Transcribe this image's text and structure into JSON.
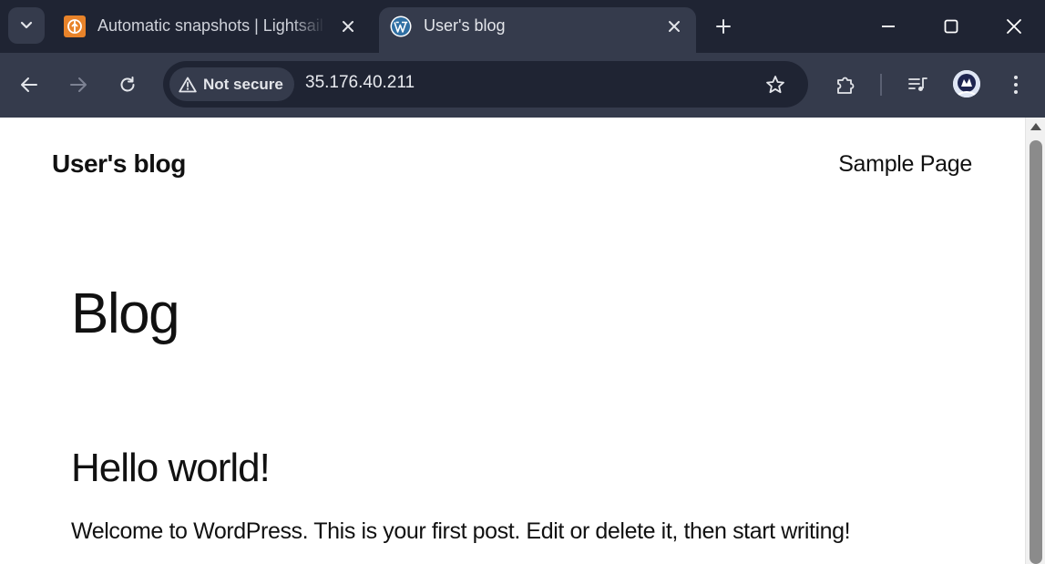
{
  "browser": {
    "tabs": [
      {
        "title": "Automatic snapshots | Lightsail",
        "favicon": "lightsail-icon",
        "active": false
      },
      {
        "title": "User's blog",
        "favicon": "wordpress-icon",
        "active": true
      }
    ],
    "address_bar": {
      "security_label": "Not secure",
      "url": "35.176.40.211"
    },
    "colors": {
      "frame": "#1f2433",
      "toolbar": "#353b4c",
      "lightsail_orange": "#e8832a",
      "wordpress_blue": "#2f6fa3"
    }
  },
  "page": {
    "site_title": "User's blog",
    "nav": {
      "sample_page": "Sample Page"
    },
    "heading": "Blog",
    "post": {
      "title": "Hello world!",
      "excerpt": "Welcome to WordPress. This is your first post. Edit or delete it, then start writing!"
    }
  }
}
